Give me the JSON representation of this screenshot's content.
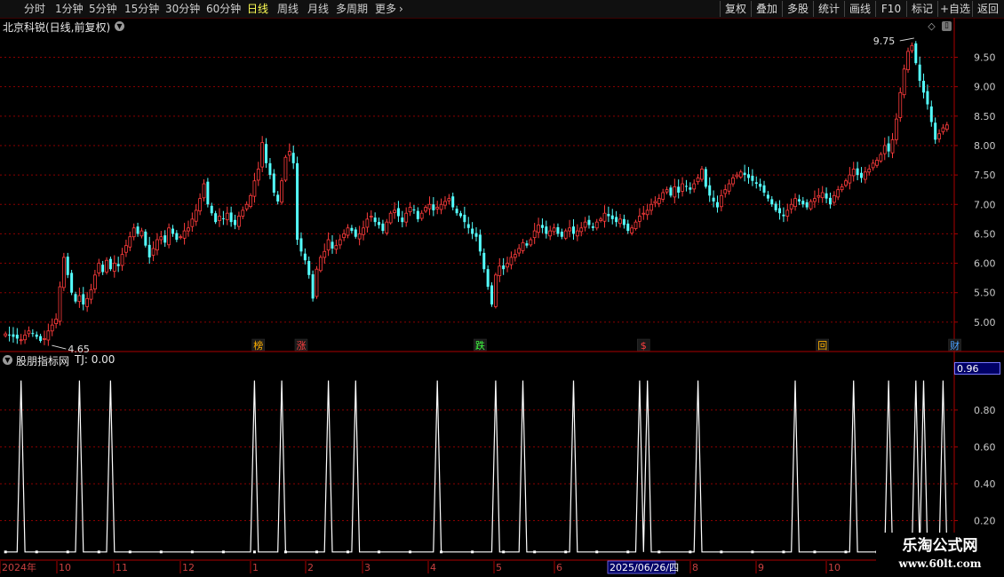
{
  "toolbar": {
    "periods": [
      "分时",
      "1分钟",
      "5分钟",
      "15分钟",
      "30分钟",
      "60分钟",
      "日线",
      "周线",
      "月线",
      "多周期",
      "更多"
    ],
    "active_period": "日线",
    "more_arrow": "›",
    "actions": [
      "复权",
      "叠加",
      "多股",
      "统计",
      "画线",
      "F10",
      "标记",
      "+自选",
      "返回"
    ]
  },
  "stock": {
    "title": "北京科锐(日线,前复权)",
    "dropdown_icon": "chevron-down"
  },
  "indicator": {
    "title": "股朋指标网",
    "value_text": "TJ: 0.00",
    "cursor_value": "0.96"
  },
  "date_axis": {
    "labels": [
      "2024年",
      "10",
      "11",
      "12",
      "1",
      "2",
      "3",
      "4",
      "5",
      "6",
      "2025/06/26/四",
      "8",
      "9",
      "10"
    ]
  },
  "watermark": {
    "name": "乐淘公式网",
    "url": "www.60lt.com"
  },
  "colors": {
    "up": "#ff3c3c",
    "down": "#54ffff",
    "grid": "#8b0000",
    "indicator_line": "#ffffff",
    "highlight": "#ffff55"
  },
  "chart_data": [
    {
      "type": "candlestick",
      "ylim": [
        4.5,
        9.9
      ],
      "y_ticks": [
        5.0,
        5.5,
        6.0,
        6.5,
        7.0,
        7.5,
        8.0,
        8.5,
        9.0,
        9.5
      ],
      "y_tick_labels": [
        "5.00",
        "5.50",
        "6.00",
        "6.50",
        "7.00",
        "7.50",
        "8.00",
        "8.50",
        "9.00",
        "9.50"
      ],
      "annotations": [
        {
          "label": "9.75",
          "value": 9.75,
          "kind": "high"
        },
        {
          "label": "4.65",
          "value": 4.65,
          "kind": "low"
        }
      ],
      "event_markers": [
        {
          "label": "榜",
          "date_index": 65,
          "color": "#ffb000"
        },
        {
          "label": "涨",
          "date_index": 76,
          "color": "#ff4040"
        },
        {
          "label": "跌",
          "date_index": 122,
          "color": "#40ff40"
        },
        {
          "label": "$",
          "date_index": 164,
          "color": "#ff4040"
        },
        {
          "label": "回",
          "date_index": 210,
          "color": "#ffb000"
        },
        {
          "label": "财",
          "date_index": 244,
          "color": "#4aa0ff"
        }
      ],
      "closes": [
        4.8,
        4.78,
        4.75,
        4.72,
        4.7,
        4.78,
        4.85,
        4.8,
        4.75,
        4.68,
        4.72,
        4.85,
        4.95,
        5.05,
        5.6,
        6.1,
        5.8,
        5.5,
        5.35,
        5.45,
        5.3,
        5.4,
        5.55,
        5.8,
        6.0,
        5.85,
        6.05,
        5.9,
        6.0,
        5.95,
        6.15,
        6.3,
        6.45,
        6.6,
        6.5,
        6.55,
        6.3,
        6.1,
        6.25,
        6.4,
        6.45,
        6.35,
        6.6,
        6.5,
        6.4,
        6.45,
        6.55,
        6.6,
        6.75,
        6.9,
        7.1,
        7.35,
        7.0,
        6.85,
        6.7,
        6.8,
        6.75,
        6.85,
        6.7,
        6.65,
        6.8,
        6.9,
        7.0,
        7.15,
        7.4,
        7.6,
        8.05,
        7.7,
        7.5,
        7.2,
        7.05,
        7.4,
        7.8,
        7.9,
        7.7,
        6.4,
        6.2,
        6.05,
        5.8,
        5.4,
        5.9,
        6.1,
        6.2,
        6.4,
        6.25,
        6.3,
        6.4,
        6.5,
        6.6,
        6.55,
        6.45,
        6.5,
        6.6,
        6.75,
        6.8,
        6.7,
        6.65,
        6.55,
        6.7,
        6.85,
        6.9,
        6.8,
        6.7,
        6.85,
        6.95,
        6.9,
        6.75,
        6.85,
        6.95,
        7.0,
        6.9,
        6.95,
        7.0,
        7.05,
        7.1,
        6.95,
        6.85,
        6.8,
        6.7,
        6.6,
        6.5,
        6.45,
        6.2,
        5.9,
        5.6,
        5.3,
        5.8,
        5.95,
        5.9,
        6.0,
        6.1,
        6.15,
        6.25,
        6.35,
        6.3,
        6.4,
        6.55,
        6.65,
        6.6,
        6.5,
        6.55,
        6.6,
        6.5,
        6.45,
        6.55,
        6.6,
        6.5,
        6.55,
        6.6,
        6.7,
        6.65,
        6.6,
        6.7,
        6.75,
        6.85,
        6.8,
        6.75,
        6.7,
        6.75,
        6.65,
        6.55,
        6.6,
        6.7,
        6.8,
        6.85,
        6.9,
        7.0,
        7.05,
        7.1,
        7.2,
        7.25,
        7.15,
        7.3,
        7.2,
        7.35,
        7.3,
        7.25,
        7.35,
        7.45,
        7.6,
        7.3,
        7.15,
        7.05,
        6.95,
        7.15,
        7.25,
        7.35,
        7.45,
        7.5,
        7.55,
        7.5,
        7.45,
        7.4,
        7.35,
        7.3,
        7.2,
        7.1,
        7.0,
        6.9,
        6.85,
        6.8,
        6.9,
        7.0,
        7.1,
        7.05,
        7.0,
        6.95,
        7.05,
        7.1,
        7.15,
        7.2,
        7.1,
        7.0,
        7.15,
        7.25,
        7.3,
        7.4,
        7.5,
        7.6,
        7.5,
        7.45,
        7.55,
        7.6,
        7.7,
        7.75,
        7.85,
        8.0,
        7.9,
        8.1,
        8.45,
        8.9,
        9.3,
        9.6,
        9.7,
        9.4,
        9.1,
        8.9,
        8.7,
        8.4,
        8.1,
        8.2,
        8.3,
        8.35
      ]
    },
    {
      "type": "line",
      "name": "TJ",
      "ylim": [
        0,
        1.05
      ],
      "y_ticks": [
        0.2,
        0.4,
        0.6,
        0.8
      ],
      "y_tick_labels": [
        "0.20",
        "0.40",
        "0.60",
        "0.80"
      ],
      "spikes": [
        4,
        19,
        27,
        64,
        71,
        83,
        90,
        111,
        126,
        133,
        146,
        163,
        165,
        178,
        203,
        218,
        227,
        234,
        236,
        241
      ]
    }
  ]
}
